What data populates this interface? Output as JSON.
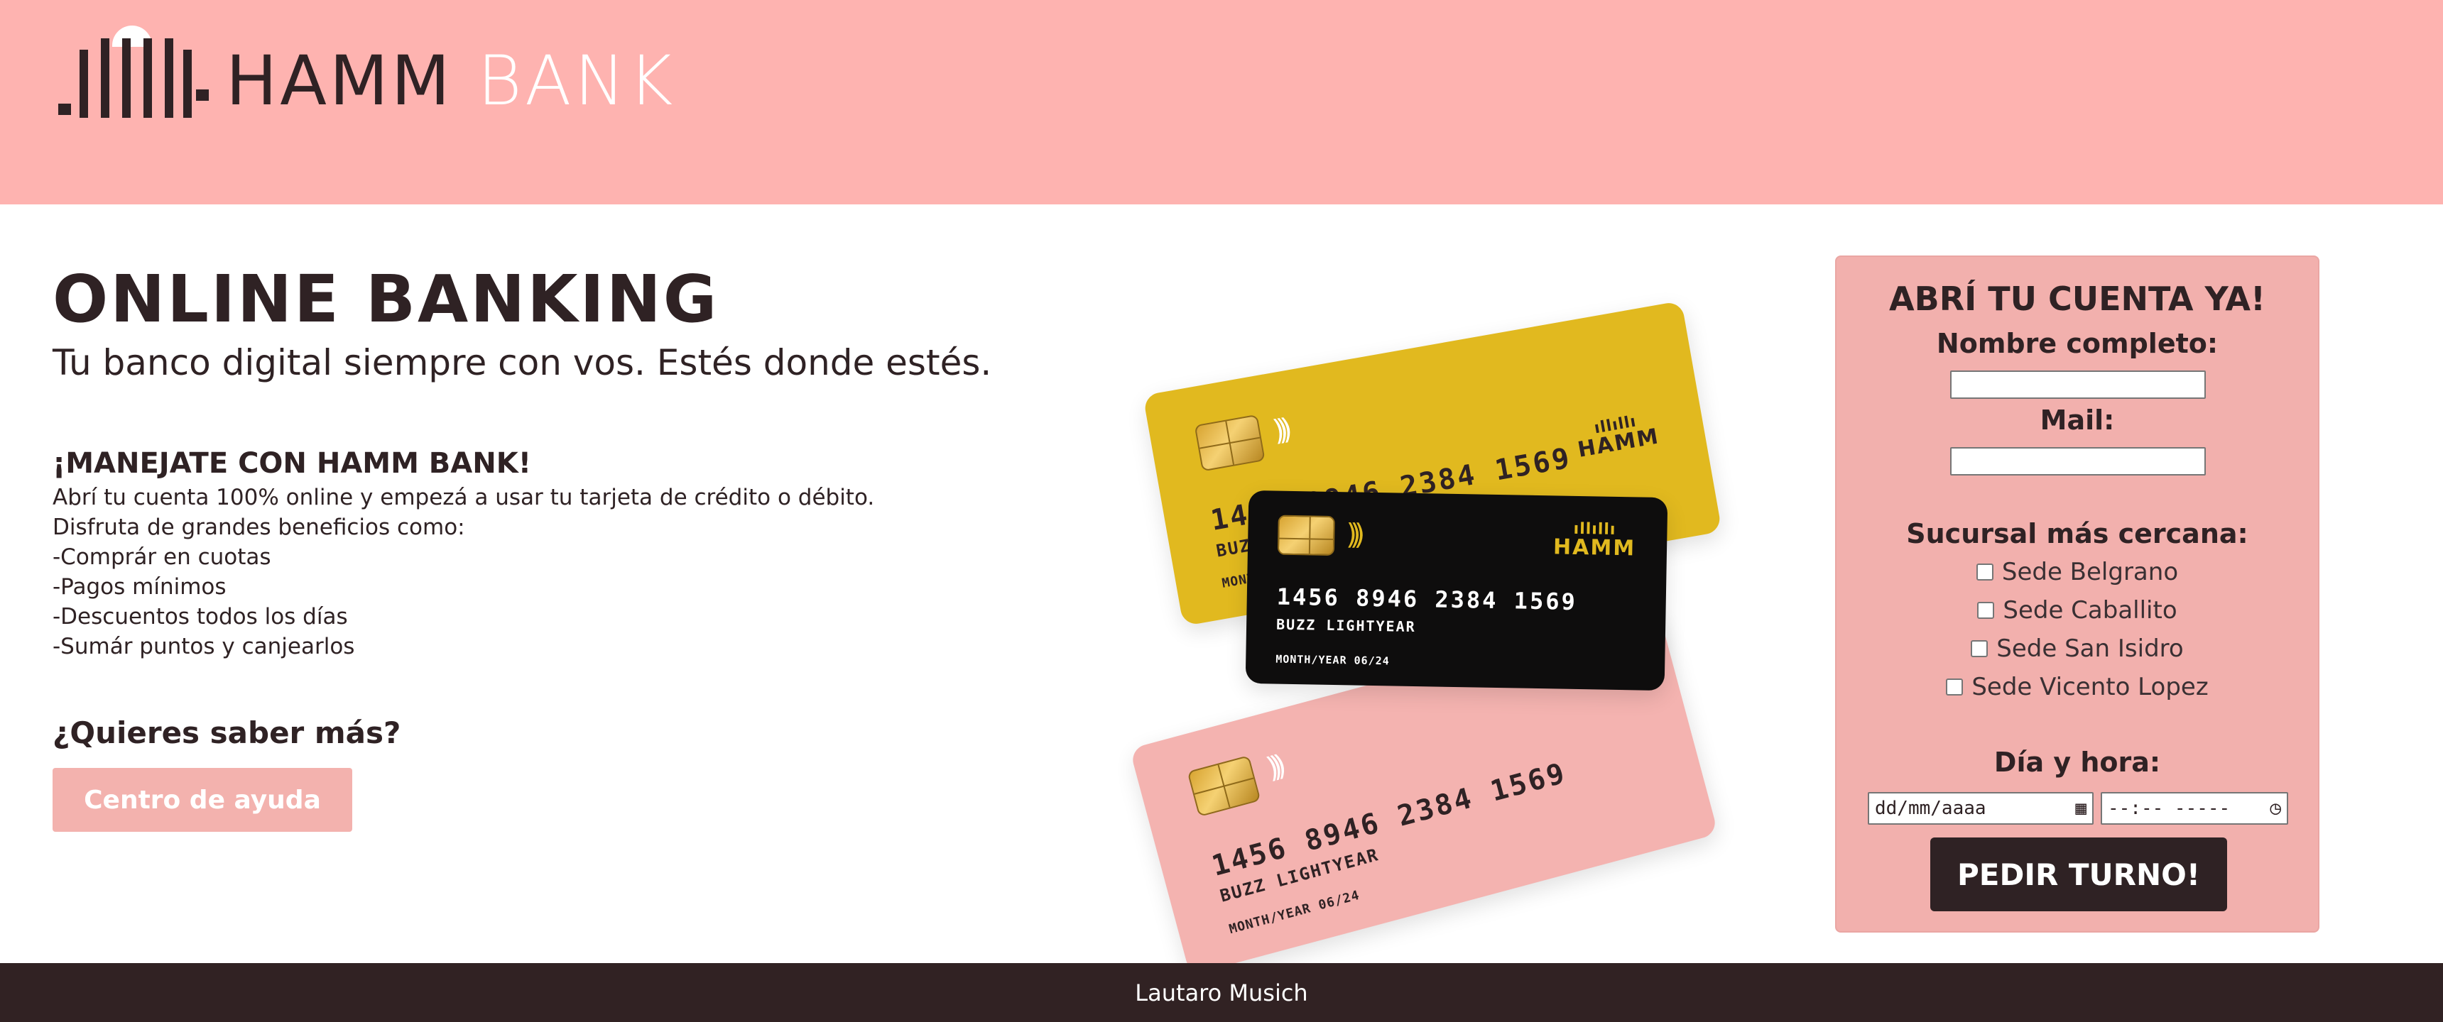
{
  "header": {
    "logo_word1": "HAMM",
    "logo_word2": "BANK",
    "background": "#feb3b0"
  },
  "hero": {
    "title": "ONLINE BANKING",
    "subtitle": "Tu banco digital siempre con vos. Estés donde estés."
  },
  "promo": {
    "title": "¡MANEJATE CON HAMM BANK!",
    "lines": [
      "Abrí tu cuenta 100% online y empezá a usar tu tarjeta de crédito o débito.",
      "Disfruta de grandes beneficios como:",
      "-Comprár en cuotas",
      "-Pagos mínimos",
      "-Descuentos todos los días",
      "-Sumár puntos y canjearlos"
    ]
  },
  "more": {
    "title": "¿Quieres saber más?",
    "help_button": "Centro de ayuda"
  },
  "cards": {
    "number": "1456 8946 2384 1569",
    "holder": "BUZZ LIGHTYEAR",
    "expiry_yellow": "MONTH/YEAR",
    "expiry": "MONTH/YEAR 06/24",
    "brand": "HAMM",
    "colors": {
      "yellow": "#e1b91f",
      "black": "#0e0d0d",
      "pink": "#f4b3b0"
    }
  },
  "form": {
    "title": "ABRÍ TU CUENTA YA!",
    "name_label": "Nombre completo:",
    "mail_label": "Mail:",
    "branch_label": "Sucursal más cercana:",
    "branches": [
      "Sede Belgrano",
      "Sede Caballito",
      "Sede San Isidro",
      "Sede Vicento Lopez"
    ],
    "datetime_label": "Día y hora:",
    "date_placeholder": "dd/mm/aaaa",
    "time_placeholder": "--:-- -----",
    "submit": "PEDIR TURNO!"
  },
  "footer": {
    "author": "Lautaro Musich",
    "background": "#312223"
  }
}
